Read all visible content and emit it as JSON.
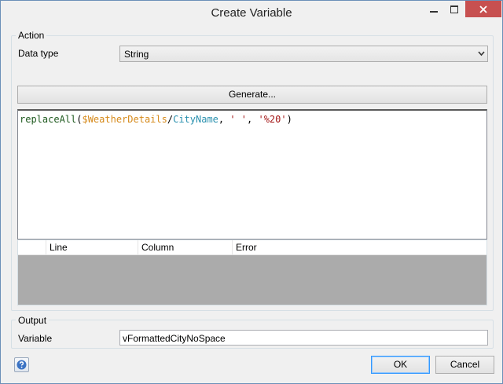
{
  "window": {
    "title": "Create Variable"
  },
  "action": {
    "group_label": "Action",
    "data_type_label": "Data type",
    "data_type_value": "String",
    "generate_label": "Generate..."
  },
  "expression": {
    "fn": "replaceAll",
    "open": "(",
    "var": "$WeatherDetails",
    "slash": "/",
    "attr": "CityName",
    "sep1": ", ",
    "arg2": "' '",
    "sep2": ", ",
    "arg3": "'%20'",
    "close": ")"
  },
  "errors": {
    "columns": [
      "Line",
      "Column",
      "Error"
    ]
  },
  "output": {
    "group_label": "Output",
    "variable_label": "Variable",
    "variable_value": "vFormattedCityNoSpace"
  },
  "footer": {
    "ok_label": "OK",
    "cancel_label": "Cancel"
  },
  "icons": {
    "minimize": "minimize-icon",
    "maximize": "maximize-icon",
    "close": "close-icon",
    "dropdown": "chevron-down-icon",
    "help": "help-icon"
  },
  "colors": {
    "close_button": "#c75050",
    "token_var": "#d68a1b",
    "token_attr": "#2b91af",
    "token_string": "#a31515",
    "token_fn": "#1f5a1f"
  }
}
